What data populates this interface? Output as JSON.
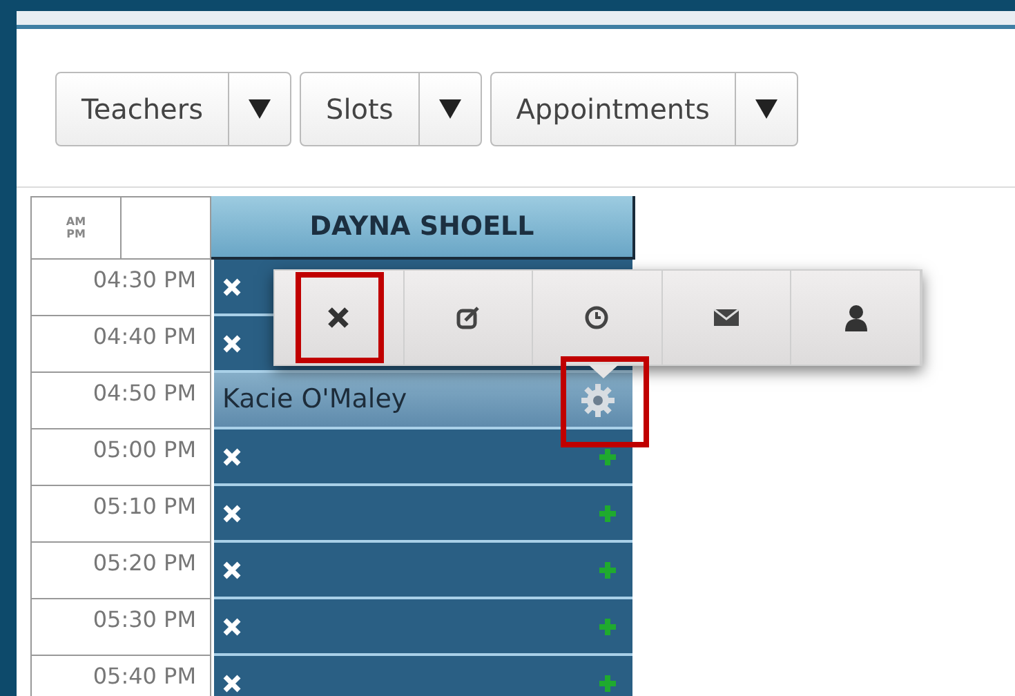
{
  "toolbar": [
    {
      "label": "Teachers"
    },
    {
      "label": "Slots"
    },
    {
      "label": "Appointments"
    }
  ],
  "schedule": {
    "ampm_label": "AM PM",
    "teacher": "DAYNA SHOELL",
    "rows": [
      {
        "time": "04:30 PM",
        "kind": "open"
      },
      {
        "time": "04:40 PM",
        "kind": "open"
      },
      {
        "time": "04:50 PM",
        "kind": "booked",
        "student": "Kacie O'Maley",
        "highlighted": true
      },
      {
        "time": "05:00 PM",
        "kind": "open",
        "add_icon": true
      },
      {
        "time": "05:10 PM",
        "kind": "open",
        "add_icon": true
      },
      {
        "time": "05:20 PM",
        "kind": "open",
        "add_icon": true
      },
      {
        "time": "05:30 PM",
        "kind": "open",
        "add_icon": true
      },
      {
        "time": "05:40 PM",
        "kind": "open",
        "add_icon": true
      }
    ]
  },
  "popup": {
    "actions": [
      {
        "kind": "delete",
        "highlighted": true
      },
      {
        "kind": "edit",
        "highlighted": false
      },
      {
        "kind": "time",
        "highlighted": false
      },
      {
        "kind": "mail",
        "highlighted": false
      },
      {
        "kind": "person",
        "highlighted": false
      }
    ]
  }
}
